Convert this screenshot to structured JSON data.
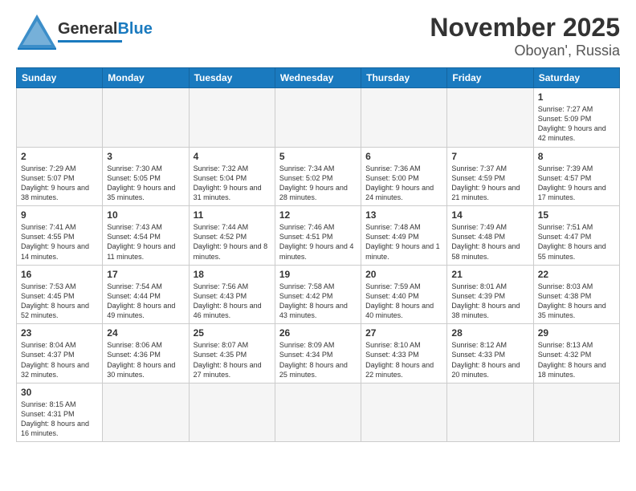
{
  "header": {
    "logo_general": "General",
    "logo_blue": "Blue",
    "title": "November 2025",
    "subtitle": "Oboyan', Russia"
  },
  "calendar": {
    "days_of_week": [
      "Sunday",
      "Monday",
      "Tuesday",
      "Wednesday",
      "Thursday",
      "Friday",
      "Saturday"
    ],
    "weeks": [
      [
        {
          "day": "",
          "info": ""
        },
        {
          "day": "",
          "info": ""
        },
        {
          "day": "",
          "info": ""
        },
        {
          "day": "",
          "info": ""
        },
        {
          "day": "",
          "info": ""
        },
        {
          "day": "",
          "info": ""
        },
        {
          "day": "1",
          "info": "Sunrise: 7:27 AM\nSunset: 5:09 PM\nDaylight: 9 hours and 42 minutes."
        }
      ],
      [
        {
          "day": "2",
          "info": "Sunrise: 7:29 AM\nSunset: 5:07 PM\nDaylight: 9 hours and 38 minutes."
        },
        {
          "day": "3",
          "info": "Sunrise: 7:30 AM\nSunset: 5:05 PM\nDaylight: 9 hours and 35 minutes."
        },
        {
          "day": "4",
          "info": "Sunrise: 7:32 AM\nSunset: 5:04 PM\nDaylight: 9 hours and 31 minutes."
        },
        {
          "day": "5",
          "info": "Sunrise: 7:34 AM\nSunset: 5:02 PM\nDaylight: 9 hours and 28 minutes."
        },
        {
          "day": "6",
          "info": "Sunrise: 7:36 AM\nSunset: 5:00 PM\nDaylight: 9 hours and 24 minutes."
        },
        {
          "day": "7",
          "info": "Sunrise: 7:37 AM\nSunset: 4:59 PM\nDaylight: 9 hours and 21 minutes."
        },
        {
          "day": "8",
          "info": "Sunrise: 7:39 AM\nSunset: 4:57 PM\nDaylight: 9 hours and 17 minutes."
        }
      ],
      [
        {
          "day": "9",
          "info": "Sunrise: 7:41 AM\nSunset: 4:55 PM\nDaylight: 9 hours and 14 minutes."
        },
        {
          "day": "10",
          "info": "Sunrise: 7:43 AM\nSunset: 4:54 PM\nDaylight: 9 hours and 11 minutes."
        },
        {
          "day": "11",
          "info": "Sunrise: 7:44 AM\nSunset: 4:52 PM\nDaylight: 9 hours and 8 minutes."
        },
        {
          "day": "12",
          "info": "Sunrise: 7:46 AM\nSunset: 4:51 PM\nDaylight: 9 hours and 4 minutes."
        },
        {
          "day": "13",
          "info": "Sunrise: 7:48 AM\nSunset: 4:49 PM\nDaylight: 9 hours and 1 minute."
        },
        {
          "day": "14",
          "info": "Sunrise: 7:49 AM\nSunset: 4:48 PM\nDaylight: 8 hours and 58 minutes."
        },
        {
          "day": "15",
          "info": "Sunrise: 7:51 AM\nSunset: 4:47 PM\nDaylight: 8 hours and 55 minutes."
        }
      ],
      [
        {
          "day": "16",
          "info": "Sunrise: 7:53 AM\nSunset: 4:45 PM\nDaylight: 8 hours and 52 minutes."
        },
        {
          "day": "17",
          "info": "Sunrise: 7:54 AM\nSunset: 4:44 PM\nDaylight: 8 hours and 49 minutes."
        },
        {
          "day": "18",
          "info": "Sunrise: 7:56 AM\nSunset: 4:43 PM\nDaylight: 8 hours and 46 minutes."
        },
        {
          "day": "19",
          "info": "Sunrise: 7:58 AM\nSunset: 4:42 PM\nDaylight: 8 hours and 43 minutes."
        },
        {
          "day": "20",
          "info": "Sunrise: 7:59 AM\nSunset: 4:40 PM\nDaylight: 8 hours and 40 minutes."
        },
        {
          "day": "21",
          "info": "Sunrise: 8:01 AM\nSunset: 4:39 PM\nDaylight: 8 hours and 38 minutes."
        },
        {
          "day": "22",
          "info": "Sunrise: 8:03 AM\nSunset: 4:38 PM\nDaylight: 8 hours and 35 minutes."
        }
      ],
      [
        {
          "day": "23",
          "info": "Sunrise: 8:04 AM\nSunset: 4:37 PM\nDaylight: 8 hours and 32 minutes."
        },
        {
          "day": "24",
          "info": "Sunrise: 8:06 AM\nSunset: 4:36 PM\nDaylight: 8 hours and 30 minutes."
        },
        {
          "day": "25",
          "info": "Sunrise: 8:07 AM\nSunset: 4:35 PM\nDaylight: 8 hours and 27 minutes."
        },
        {
          "day": "26",
          "info": "Sunrise: 8:09 AM\nSunset: 4:34 PM\nDaylight: 8 hours and 25 minutes."
        },
        {
          "day": "27",
          "info": "Sunrise: 8:10 AM\nSunset: 4:33 PM\nDaylight: 8 hours and 22 minutes."
        },
        {
          "day": "28",
          "info": "Sunrise: 8:12 AM\nSunset: 4:33 PM\nDaylight: 8 hours and 20 minutes."
        },
        {
          "day": "29",
          "info": "Sunrise: 8:13 AM\nSunset: 4:32 PM\nDaylight: 8 hours and 18 minutes."
        }
      ],
      [
        {
          "day": "30",
          "info": "Sunrise: 8:15 AM\nSunset: 4:31 PM\nDaylight: 8 hours and 16 minutes."
        },
        {
          "day": "",
          "info": ""
        },
        {
          "day": "",
          "info": ""
        },
        {
          "day": "",
          "info": ""
        },
        {
          "day": "",
          "info": ""
        },
        {
          "day": "",
          "info": ""
        },
        {
          "day": "",
          "info": ""
        }
      ]
    ]
  }
}
